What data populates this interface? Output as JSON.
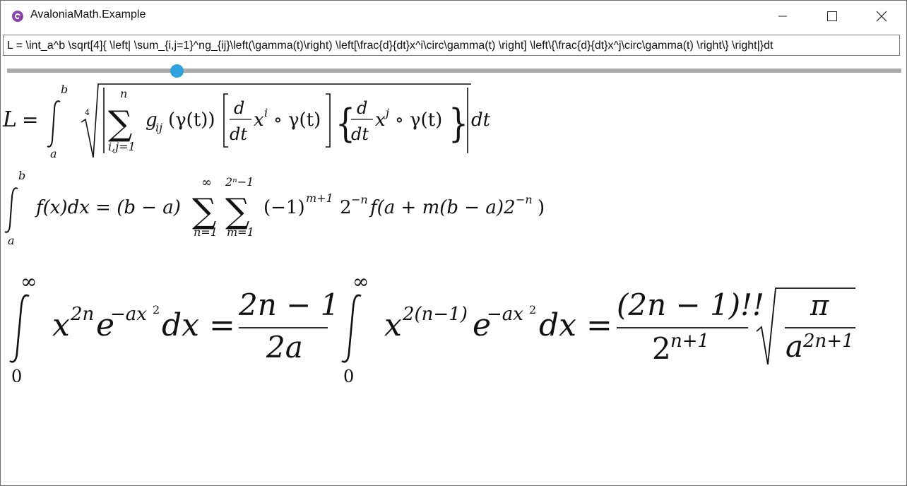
{
  "window": {
    "title": "AvaloniaMath.Example",
    "icon": "avalonia-logo-icon",
    "controls": [
      "minimize-icon",
      "maximize-icon",
      "close-icon"
    ]
  },
  "formula_input": {
    "value": "L = \\int_a^b \\sqrt[4]{ \\left| \\sum_{i,j=1}^ng_{ij}\\left(\\gamma(t)\\right) \\left[\\frac{d}{dt}x^i\\circ\\gamma(t) \\right] \\left\\{\\frac{d}{dt}x^j\\circ\\gamma(t) \\right\\} \\right|}dt"
  },
  "scale_slider": {
    "value_fraction": 0.19
  },
  "rendered_math": {
    "eq1": {
      "L": "L",
      "eq": "=",
      "int_upper": "b",
      "int_lower": "a",
      "root_index": "4",
      "sum_upper": "n",
      "sum_lower": "i,j=1",
      "g": "g",
      "g_sub": "ij",
      "gamma_arg": "(γ(t))",
      "frac_num": "d",
      "frac_den": "dt",
      "xi": "x",
      "xi_sup": "i",
      "circ_gamma": "∘ γ(t)",
      "xj": "x",
      "xj_sup": "j",
      "dt": "dt"
    },
    "eq2": {
      "int_upper": "b",
      "int_lower": "a",
      "fx": "f(x)dx = (b − a)",
      "sum1_upper": "∞",
      "sum1_lower": "n=1",
      "sum2_upper": "2ⁿ−1",
      "sum2_lower": "m=1",
      "neg1": "(−1)",
      "exp1": "m+1",
      "two": "2",
      "exp2": "−n",
      "rest": "f(a + m(b − a)2",
      "exp3": "−n",
      "close": ")"
    },
    "eq3": {
      "int_upper": "∞",
      "int_lower": "0",
      "x": "x",
      "x_exp": "2n",
      "e": "e",
      "e_exp": "−ax",
      "e_exp_sq": "2",
      "dx_eq": "dx =",
      "frac1_num": "2n − 1",
      "frac1_den": "2a",
      "int2_upper": "∞",
      "int2_lower": "0",
      "x2": "x",
      "x2_exp": "2(n−1)",
      "e2": "e",
      "e2_exp": "−ax",
      "e2_exp_sq": "2",
      "dx_eq2": "dx =",
      "frac2_num": "(2n − 1)!!",
      "frac2_den": "2",
      "frac2_den_exp": "n+1",
      "sqrt_num": "π",
      "sqrt_den": "a",
      "sqrt_den_exp": "2n+1"
    }
  }
}
